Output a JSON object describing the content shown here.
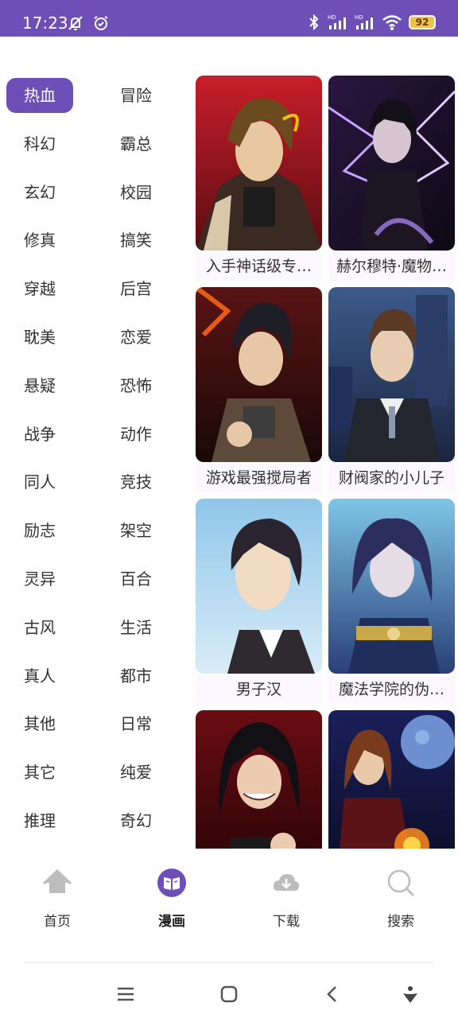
{
  "status_bar": {
    "time": "17:23",
    "battery": "92",
    "left_icons": [
      "muted-bell-icon",
      "alarm-clock-icon"
    ],
    "right_icons": [
      "bluetooth-icon",
      "signal-hd-icon",
      "signal-hd-icon",
      "wifi-icon",
      "battery-icon"
    ]
  },
  "categories": [
    {
      "label": "热血",
      "active": true
    },
    {
      "label": "冒险"
    },
    {
      "label": "科幻"
    },
    {
      "label": "霸总"
    },
    {
      "label": "玄幻"
    },
    {
      "label": "校园"
    },
    {
      "label": "修真"
    },
    {
      "label": "搞笑"
    },
    {
      "label": "穿越"
    },
    {
      "label": "后宫"
    },
    {
      "label": "耽美"
    },
    {
      "label": "恋爱"
    },
    {
      "label": "悬疑"
    },
    {
      "label": "恐怖"
    },
    {
      "label": "战争"
    },
    {
      "label": "动作"
    },
    {
      "label": "同人"
    },
    {
      "label": "竞技"
    },
    {
      "label": "励志"
    },
    {
      "label": "架空"
    },
    {
      "label": "灵异"
    },
    {
      "label": "百合"
    },
    {
      "label": "古风"
    },
    {
      "label": "生活"
    },
    {
      "label": "真人"
    },
    {
      "label": "都市"
    },
    {
      "label": "其他"
    },
    {
      "label": "日常"
    },
    {
      "label": "其它"
    },
    {
      "label": "纯爱"
    },
    {
      "label": "推理"
    },
    {
      "label": "奇幻"
    }
  ],
  "comics": [
    {
      "title": "入手神话级专…"
    },
    {
      "title": "赫尔穆特·魔物…"
    },
    {
      "title": "游戏最强搅局者"
    },
    {
      "title": "财阀家的小儿子"
    },
    {
      "title": "男子汉"
    },
    {
      "title": "魔法学院的伪…"
    },
    {
      "title": ""
    },
    {
      "title": ""
    }
  ],
  "bottom_nav": {
    "home": "首页",
    "comics": "漫画",
    "download": "下载",
    "search": "搜索"
  },
  "colors": {
    "accent": "#6e4fb7",
    "inactive_icon": "#b9b9b9"
  }
}
